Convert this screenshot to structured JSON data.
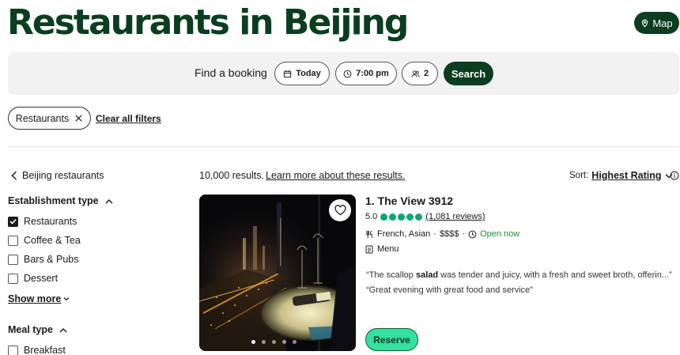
{
  "header": {
    "title": "Restaurants in Beijing",
    "map_label": "Map"
  },
  "booking": {
    "label": "Find a booking",
    "date": "Today",
    "time": "7:00 pm",
    "guests": "2",
    "search_label": "Search"
  },
  "filters": {
    "active_chip": "Restaurants",
    "clear_label": "Clear all filters"
  },
  "sidebar": {
    "back_label": "Beijing restaurants",
    "establishment": {
      "heading": "Establishment type",
      "items": [
        {
          "label": "Restaurants",
          "checked": true
        },
        {
          "label": "Coffee & Tea",
          "checked": false
        },
        {
          "label": "Bars & Pubs",
          "checked": false
        },
        {
          "label": "Dessert",
          "checked": false
        }
      ],
      "show_more": "Show more"
    },
    "meal": {
      "heading": "Meal type",
      "items": [
        {
          "label": "Breakfast",
          "checked": false
        }
      ]
    }
  },
  "results": {
    "count": "10,000 results.",
    "learn_more": "Learn more about these results.",
    "sort_label": "Sort:",
    "sort_value": "Highest Rating"
  },
  "listing": {
    "title": "1. The View 3912",
    "rating": "5.0",
    "bubbles_filled": 5,
    "reviews": "(1,081 reviews)",
    "cuisine": "French, Asian",
    "price": "$$$$",
    "status": "Open now",
    "menu_label": "Menu",
    "quote1_pre": "“The scallop ",
    "quote1_bold": "salad",
    "quote1_post": " was tender and juicy, with a fresh and sweet broth, offerin...”",
    "quote2": "“Great evening with great food and service”",
    "reserve_label": "Reserve",
    "photo_count": 5,
    "photo_active": 0
  },
  "colors": {
    "brand_dark": "#0b3d1f",
    "rating_green": "#00aa6c",
    "reserve_green": "#34e0a1",
    "open_green": "#2a8a3a"
  }
}
